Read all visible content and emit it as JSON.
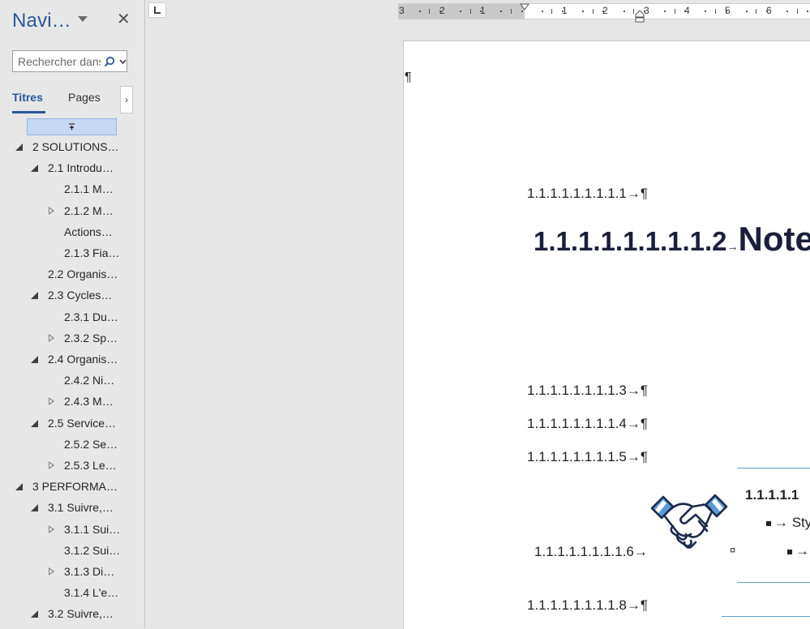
{
  "nav": {
    "title": "Navi…",
    "search_placeholder": "Rechercher dans le document",
    "tabs": {
      "titres": "Titres",
      "pages": "Pages",
      "more": "›"
    },
    "tree": [
      {
        "label": "2 SOLUTIONS…",
        "state": "open"
      },
      {
        "label": "2.1 Introdu…",
        "state": "open"
      },
      {
        "label": "2.1.1 M…",
        "state": "none"
      },
      {
        "label": "2.1.2 M…",
        "state": "closed"
      },
      {
        "label": "Actions…",
        "state": "none"
      },
      {
        "label": "2.1.3 Fia…",
        "state": "none"
      },
      {
        "label": "2.2 Organis…",
        "state": "none"
      },
      {
        "label": "2.3 Cycles…",
        "state": "open"
      },
      {
        "label": "2.3.1 Du…",
        "state": "none"
      },
      {
        "label": "2.3.2 Sp…",
        "state": "closed"
      },
      {
        "label": "2.4 Organis…",
        "state": "open"
      },
      {
        "label": "2.4.2 Ni…",
        "state": "none"
      },
      {
        "label": "2.4.3 M…",
        "state": "closed"
      },
      {
        "label": "2.5 Service…",
        "state": "open"
      },
      {
        "label": "2.5.2 Se…",
        "state": "none"
      },
      {
        "label": "2.5.3 Le…",
        "state": "closed"
      },
      {
        "label": "3 PERFORMA…",
        "state": "open"
      },
      {
        "label": "3.1 Suivre,…",
        "state": "open"
      },
      {
        "label": "3.1.1 Sui…",
        "state": "closed"
      },
      {
        "label": "3.1.2 Sui…",
        "state": "none"
      },
      {
        "label": "3.1.3 Di…",
        "state": "closed"
      },
      {
        "label": "3.1.4 L'e…",
        "state": "none"
      },
      {
        "label": "3.2 Suivre,…",
        "state": "open"
      }
    ]
  },
  "ruler": {
    "left_numbers": [
      "3",
      "2",
      "1"
    ],
    "right_numbers": [
      "1",
      "2",
      "3",
      "4",
      "5",
      "6"
    ]
  },
  "document": {
    "empty_pilcrow": "¶",
    "para_1": "1.1.1.1.1.1.1.1.1→¶",
    "heading_number": "1.1.1.1.1.1.1.1.2",
    "heading_arrow": "→",
    "heading_text": "Note",
    "para_3": "1.1.1.1.1.1.1.1.3→¶",
    "para_4": "1.1.1.1.1.1.1.1.4→¶",
    "para_5": "1.1.1.1.1.1.1.1.5→¶",
    "para_6": "1.1.1.1.1.1.1.1.6→",
    "cell_mark": "¤",
    "table_heading": "1.1.1.1.1",
    "bullet_1": "→ Styl",
    "bullet_2": "→ S",
    "para_8": "1.1.1.1.1.1.1.1.8→¶"
  },
  "colors": {
    "accent": "#2b579a",
    "heading_navy": "#1b1f3b",
    "table_border": "#5b9bd5",
    "selection": "#c5d9f3"
  },
  "icons": [
    "menu-caret-icon",
    "close-icon",
    "search-icon",
    "chevron-down-icon",
    "collapse-all-icon",
    "expand-triangle-icon",
    "collapsed-triangle-icon",
    "tab-stop-icon",
    "indent-marker-icon",
    "handshake-icon"
  ]
}
